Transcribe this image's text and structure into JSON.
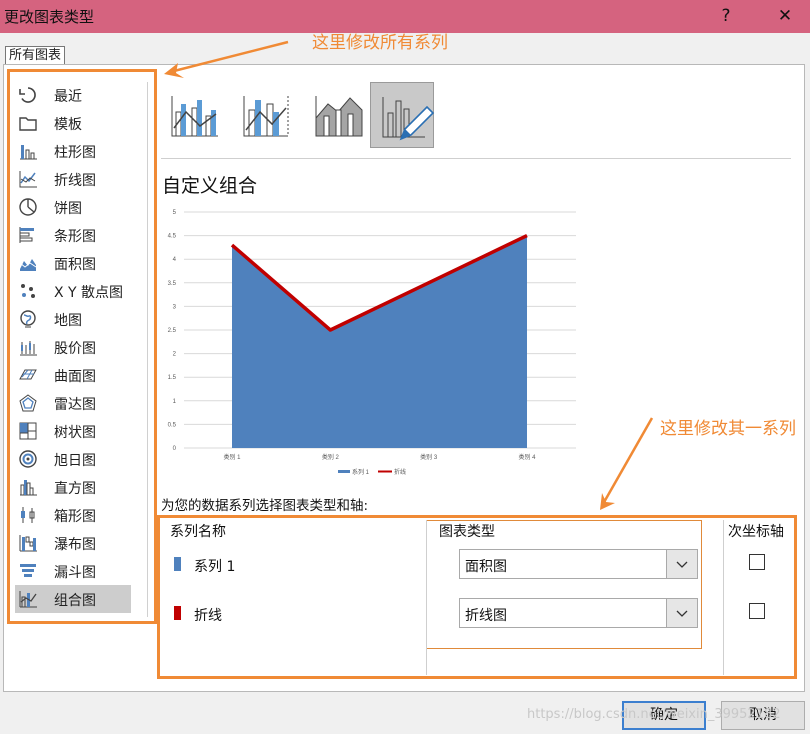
{
  "window": {
    "title": "更改图表类型",
    "help_glyph": "?",
    "close_glyph": "✕"
  },
  "tab": "所有图表",
  "sidebar": {
    "items": [
      {
        "label": "最近",
        "icon": "recent-icon"
      },
      {
        "label": "模板",
        "icon": "template-folder-icon"
      },
      {
        "label": "柱形图",
        "icon": "column-chart-icon"
      },
      {
        "label": "折线图",
        "icon": "line-chart-icon"
      },
      {
        "label": "饼图",
        "icon": "pie-chart-icon"
      },
      {
        "label": "条形图",
        "icon": "bar-chart-icon"
      },
      {
        "label": "面积图",
        "icon": "area-chart-icon"
      },
      {
        "label": "X Y 散点图",
        "icon": "scatter-chart-icon"
      },
      {
        "label": "地图",
        "icon": "map-chart-icon"
      },
      {
        "label": "股价图",
        "icon": "stock-chart-icon"
      },
      {
        "label": "曲面图",
        "icon": "surface-chart-icon"
      },
      {
        "label": "雷达图",
        "icon": "radar-chart-icon"
      },
      {
        "label": "树状图",
        "icon": "treemap-chart-icon"
      },
      {
        "label": "旭日图",
        "icon": "sunburst-chart-icon"
      },
      {
        "label": "直方图",
        "icon": "histogram-chart-icon"
      },
      {
        "label": "箱形图",
        "icon": "box-whisker-chart-icon"
      },
      {
        "label": "瀑布图",
        "icon": "waterfall-chart-icon"
      },
      {
        "label": "漏斗图",
        "icon": "funnel-chart-icon"
      },
      {
        "label": "组合图",
        "icon": "combo-chart-icon"
      }
    ],
    "selected_index": 18
  },
  "combo_types": [
    {
      "icon": "clustered-column-line-icon"
    },
    {
      "icon": "column-line-secondary-axis-icon"
    },
    {
      "icon": "stacked-area-column-icon"
    },
    {
      "icon": "custom-combo-icon",
      "selected": true
    }
  ],
  "combo_title": "自定义组合",
  "chart_data": {
    "type": "area",
    "categories": [
      "类别 1",
      "类别 2",
      "类别 3",
      "类别 4"
    ],
    "series": [
      {
        "name": "系列 1",
        "chart": "area",
        "values": [
          4.3,
          2.5,
          3.5,
          4.5
        ],
        "color": "#4f81bd"
      },
      {
        "name": "折线",
        "chart": "line",
        "values": [
          4.3,
          2.5,
          3.5,
          4.5
        ],
        "color": "#c00000"
      }
    ],
    "ylim": [
      0,
      5
    ],
    "yticks": [
      "0",
      "0.5",
      "1",
      "1.5",
      "2",
      "2.5",
      "3",
      "3.5",
      "4",
      "4.5",
      "5"
    ],
    "grid": true,
    "legend": "bottom"
  },
  "series_prompt": "为您的数据系列选择图表类型和轴:",
  "table": {
    "headers": {
      "name": "系列名称",
      "type": "图表类型",
      "secondary": "次坐标轴"
    },
    "rows": [
      {
        "name": "系列 1",
        "color": "#4f81bd",
        "type": "面积图",
        "secondary": false
      },
      {
        "name": "折线",
        "color": "#c00000",
        "type": "折线图",
        "secondary": false
      }
    ]
  },
  "buttons": {
    "ok": "确定",
    "cancel": "取消"
  },
  "annotations": {
    "all_series": "这里修改所有系列",
    "one_series": "这里修改其一系列"
  },
  "watermark": "https://blog.csdn.net/weixin_39952182",
  "colors": {
    "accent": "#f08a35",
    "titlebar": "#d5637f",
    "area": "#4f81bd",
    "line": "#c00000"
  }
}
